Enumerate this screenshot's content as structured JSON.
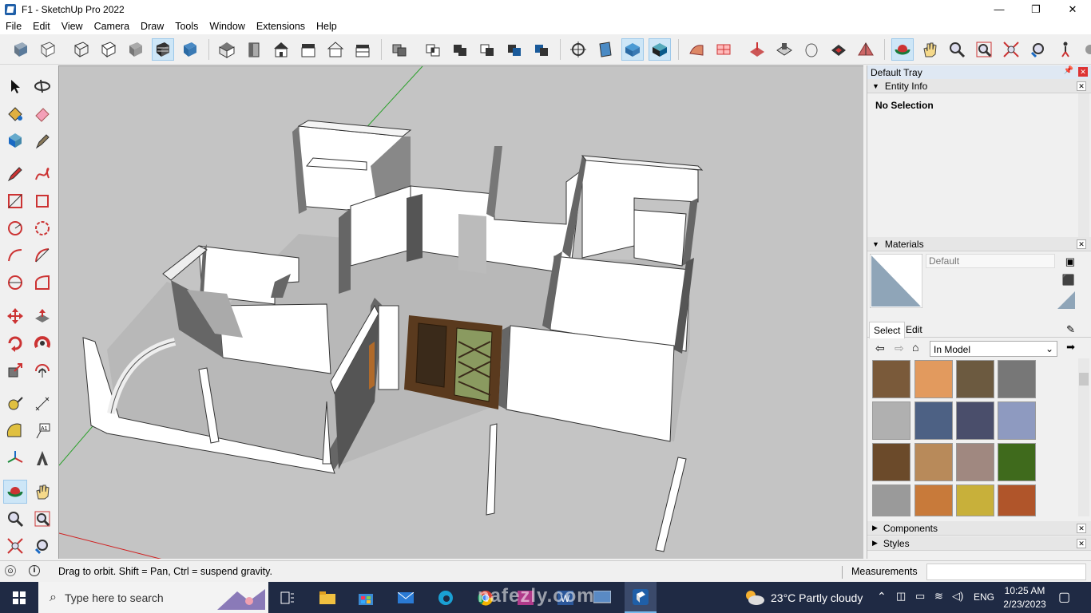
{
  "window": {
    "title": "F1 - SketchUp Pro 2022",
    "min": "—",
    "max": "❐",
    "close": "✕"
  },
  "menu": [
    "File",
    "Edit",
    "View",
    "Camera",
    "Draw",
    "Tools",
    "Window",
    "Extensions",
    "Help"
  ],
  "tray": {
    "title": "Default Tray",
    "entity_info": {
      "label": "Entity Info",
      "selection": "No Selection"
    },
    "materials": {
      "label": "Materials",
      "name_placeholder": "Default",
      "tab_select": "Select",
      "tab_edit": "Edit",
      "collection": "In Model",
      "swatch_colors": [
        "#7a5a3a",
        "#e29a5e",
        "#6c5a40",
        "#777777",
        "#b0b0b0",
        "#4d6184",
        "#4a4e6b",
        "#8e9ac0",
        "#6b4a2a",
        "#b88a5a",
        "#a08880",
        "#3f6a1c",
        "#9a9a9a",
        "#c87a3a",
        "#c8b03a",
        "#b0552a"
      ]
    },
    "components": "Components",
    "styles": "Styles"
  },
  "status": {
    "hint": "Drag to orbit. Shift = Pan, Ctrl = suspend gravity.",
    "measurements_label": "Measurements",
    "measurements_value": ""
  },
  "taskbar": {
    "search_placeholder": "Type here to search",
    "weather": "23°C  Partly cloudy",
    "lang": "ENG",
    "time": "10:25 AM",
    "date": "2/23/2023"
  },
  "watermark": "nafezly.com",
  "colors": {
    "viewport_bg": "#c4c4c4",
    "accent": "#0078d7",
    "taskbar": "#1f2a44"
  }
}
